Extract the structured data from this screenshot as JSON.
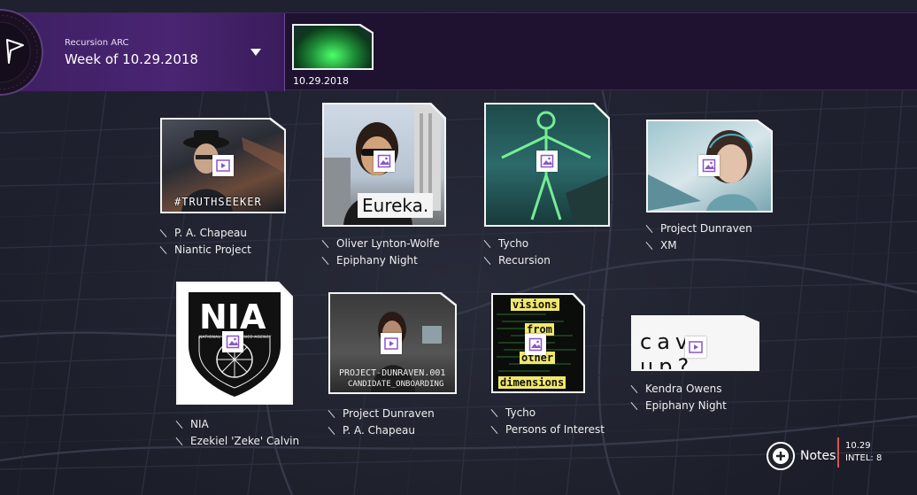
{
  "header": {
    "arc_subtitle": "Recursion ARC",
    "arc_title": "Week of 10.29.2018",
    "week_thumb_date": "10.29.2018"
  },
  "cards": [
    {
      "id": "truthseeker",
      "overlay": "#TRUTHSEEKER",
      "media": "video-icon",
      "tags": [
        "P. A. Chapeau",
        "Niantic Project"
      ]
    },
    {
      "id": "eureka",
      "overlay": "Eureka.",
      "media": "image-icon",
      "tags": [
        "Oliver Lynton-Wolfe",
        "Epiphany Night"
      ]
    },
    {
      "id": "tycho-recursion",
      "overlay": "",
      "media": "image-icon",
      "tags": [
        "Tycho",
        "Recursion"
      ]
    },
    {
      "id": "dunraven-xm",
      "overlay": "",
      "media": "image-icon",
      "tags": [
        "Project Dunraven",
        "XM"
      ]
    },
    {
      "id": "nia",
      "overlay": "NIA",
      "overlay2": "NATIONAL INTELLIGENCE AGENCY",
      "media": "image-icon",
      "tags": [
        "NIA",
        "Ezekiel 'Zeke' Calvin"
      ]
    },
    {
      "id": "dunraven-onboarding",
      "overlay": "PROJECT-DUNRAVEN.001",
      "overlay2": "CANDIDATE_ONBOARDING",
      "media": "video-icon",
      "tags": [
        "Project Dunraven",
        "P. A. Chapeau"
      ]
    },
    {
      "id": "visions",
      "overlay_lines": [
        "visions",
        "from",
        "other",
        "dimensions"
      ],
      "media": "image-icon",
      "tags": [
        "Tycho",
        "Persons of Interest"
      ]
    },
    {
      "id": "cave-up",
      "overlay": "cave up?",
      "media": "video-icon",
      "tags": [
        "Kendra Owens",
        "Epiphany Night"
      ]
    }
  ],
  "footer": {
    "notes_label": "Notes",
    "intel_date": "10.29",
    "intel_count": "INTEL: 8"
  },
  "colors": {
    "header_bg": "#1e1230",
    "arc_panel": "#4a2572",
    "accent_red": "#d9534f",
    "media_icon": "#8a55c8"
  }
}
